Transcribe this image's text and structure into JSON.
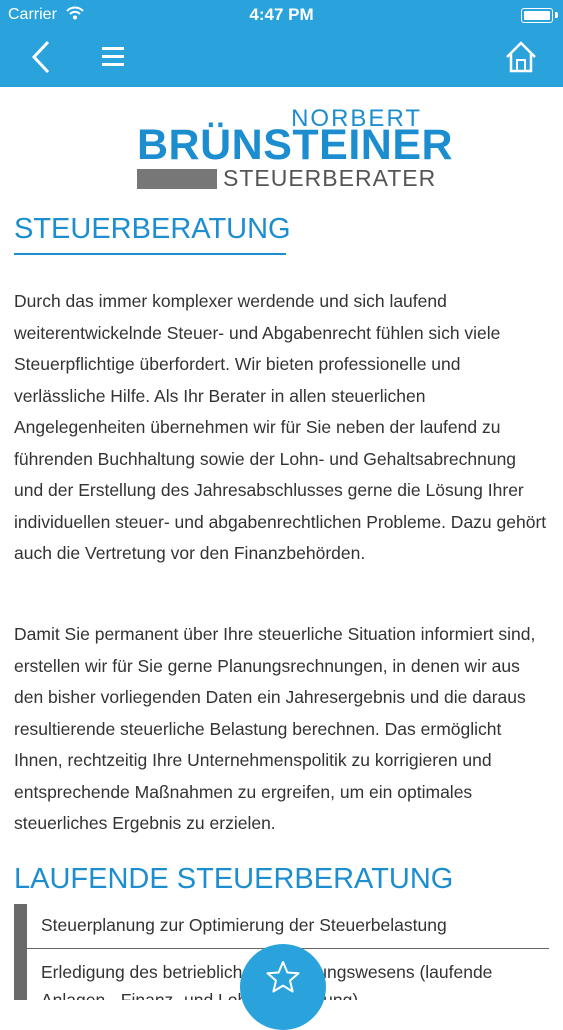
{
  "status_bar": {
    "carrier": "Carrier",
    "time": "4:47 PM"
  },
  "nav": {
    "icons": [
      "chevron-left-icon",
      "hamburger-menu-icon",
      "home-icon"
    ]
  },
  "logo": {
    "line1": "NORBERT",
    "line2": "BRÜNSTEINER",
    "line3": "STEUERBERATER"
  },
  "content": {
    "heading1": "STEUERBERATUNG",
    "paragraph1": "Durch das immer komplexer werdende und sich laufend weiterentwickelnde Steuer- und Abgabenrecht fühlen sich viele Steuerpflichtige überfordert. Wir bieten professionelle und verlässliche Hilfe. Als Ihr Berater in allen steuerlichen Angelegenheiten übernehmen wir für Sie neben der laufend zu führenden Buchhaltung sowie der Lohn- und Gehaltsabrechnung und der Erstellung des Jahresabschlusses gerne die Lösung Ihrer individuellen steuer- und abgabenrechtlichen Probleme. Dazu gehört auch die Vertretung vor den Finanzbehörden.",
    "paragraph2": "Damit Sie permanent über Ihre steuerliche Situation informiert sind, erstellen wir für Sie gerne Planungsrechnungen, in denen wir aus den bisher vorliegenden Daten ein Jahresergebnis und die daraus resultierende steuerliche Belastung berechnen. Das ermöglicht Ihnen, rechtzeitig Ihre Unternehmenspolitik zu korrigieren und entsprechende Maßnahmen zu ergreifen, um ein optimales steuerliches Ergebnis zu erzielen.",
    "heading2": "LAUFENDE STEUERBERATUNG",
    "list": [
      "Steuerplanung zur Optimierung der Steuerbelastung",
      "Erledigung des betrieblichen Rechnungswesens (laufende Anlagen-, Finanz- und Lohnbuchhaltung)"
    ]
  },
  "fab": {
    "icon": "star-icon"
  },
  "colors": {
    "accent": "#2aa3dc",
    "heading": "#1c8ed0",
    "list_bar": "#6a6a6a"
  }
}
